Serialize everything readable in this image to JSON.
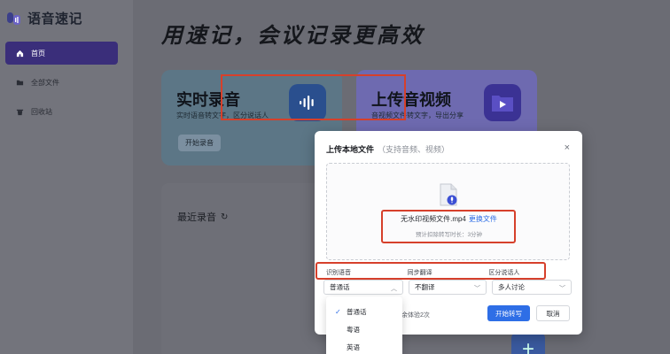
{
  "app": {
    "name": "语音速记"
  },
  "sidebar": {
    "items": [
      {
        "label": "首页",
        "icon": "home-icon",
        "active": true
      },
      {
        "label": "全部文件",
        "icon": "folder-icon",
        "active": false
      },
      {
        "label": "回收站",
        "icon": "trash-icon",
        "active": false
      }
    ]
  },
  "main": {
    "headline": "用速记，会议记录更高效",
    "cards": {
      "live": {
        "title": "实时录音",
        "subtitle": "实时语音转文字，区分说话人",
        "button": "开始录音",
        "icon": "microphone-wave-icon"
      },
      "upload": {
        "title": "上传音视频",
        "subtitle": "音视频文件转文字，导出分享",
        "icon": "video-folder-icon"
      }
    },
    "recent": {
      "title": "最近录音",
      "refresh_icon": "refresh-icon"
    }
  },
  "modal": {
    "title": "上传本地文件",
    "title_hint": "（支持音频、视频）",
    "close_label": "×",
    "file_name": "无水印视频文件.mp4",
    "change_file": "更换文件",
    "estimate": "预计扣除转写时长：3分钟",
    "options": {
      "language_label": "识别语音",
      "translate_label": "同步翻译",
      "speaker_label": "区分说话人",
      "language_value": "普通话",
      "translate_value": "不翻译",
      "speaker_value": "多人讨论"
    },
    "note": "余体验2次",
    "submit": "开始转写",
    "cancel": "取消"
  },
  "dropdown": {
    "items": [
      {
        "label": "普通话",
        "selected": true
      },
      {
        "label": "粤语",
        "selected": false
      },
      {
        "label": "英语",
        "selected": false
      }
    ]
  },
  "colors": {
    "accent": "#2e6ee6",
    "sidebar_active": "#3a2e7a",
    "highlight": "#d6402b"
  }
}
